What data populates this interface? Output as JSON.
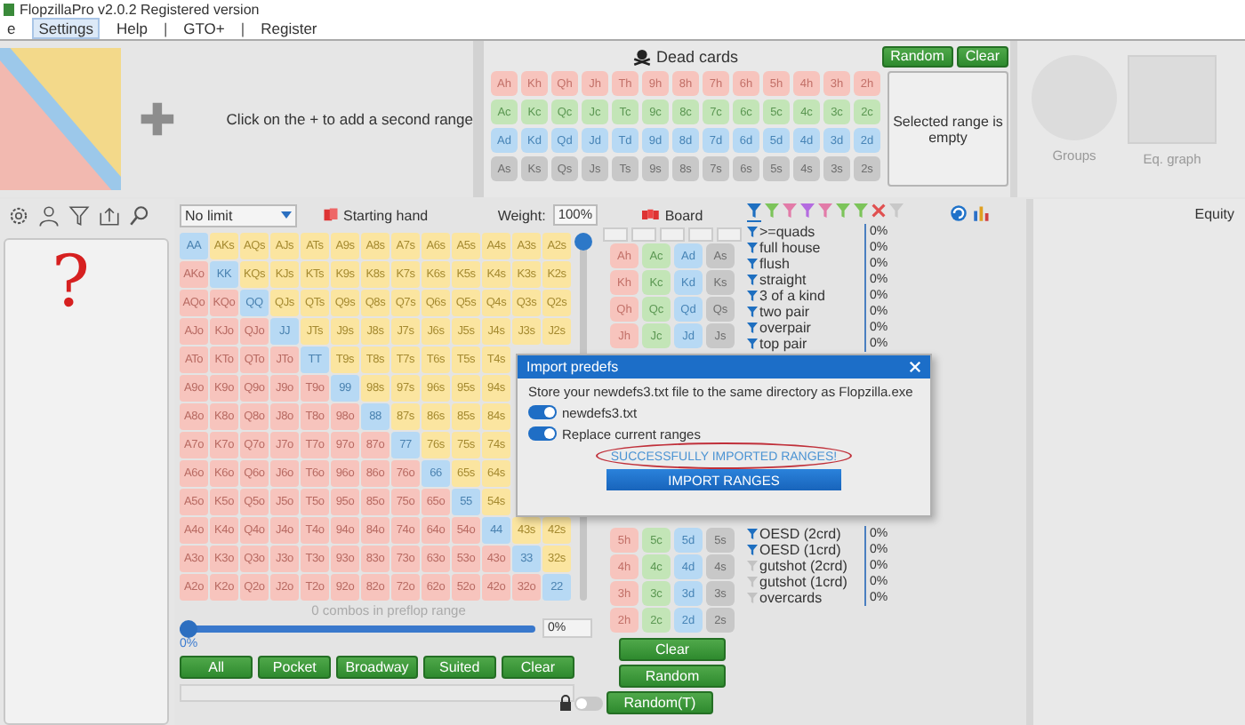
{
  "window": {
    "title": "FlopzillaPro v2.0.2 Registered version"
  },
  "menu": [
    {
      "kind": "item",
      "label": "e",
      "selected": false
    },
    {
      "kind": "item",
      "label": "Settings",
      "selected": true
    },
    {
      "kind": "item",
      "label": "Help",
      "selected": false
    },
    {
      "kind": "separator",
      "label": "|"
    },
    {
      "kind": "item",
      "label": "GTO+",
      "selected": false
    },
    {
      "kind": "separator",
      "label": "|"
    },
    {
      "kind": "item",
      "label": "Register",
      "selected": false
    }
  ],
  "second_range": {
    "hint": "Click on the + to add a second range"
  },
  "dead_cards": {
    "title": "Dead cards",
    "rows": [
      [
        "Ah",
        "Kh",
        "Qh",
        "Jh",
        "Th",
        "9h",
        "8h",
        "7h",
        "6h",
        "5h",
        "4h",
        "3h",
        "2h"
      ],
      [
        "Ac",
        "Kc",
        "Qc",
        "Jc",
        "Tc",
        "9c",
        "8c",
        "7c",
        "6c",
        "5c",
        "4c",
        "3c",
        "2c"
      ],
      [
        "Ad",
        "Kd",
        "Qd",
        "Jd",
        "Td",
        "9d",
        "8d",
        "7d",
        "6d",
        "5d",
        "4d",
        "3d",
        "2d"
      ],
      [
        "As",
        "Ks",
        "Qs",
        "Js",
        "Ts",
        "9s",
        "8s",
        "7s",
        "6s",
        "5s",
        "4s",
        "3s",
        "2s"
      ]
    ],
    "buttons": [
      "Random",
      "Clear"
    ],
    "summary": "Selected range is empty"
  },
  "analysis": {
    "groups_label": "Groups",
    "graph_label": "Eq. graph"
  },
  "sidebar": {
    "note": "?"
  },
  "range": {
    "game": "No limit",
    "title": "Starting hand",
    "weight_label": "Weight:",
    "weight": "100%",
    "weight_slider": {
      "level": 1
    },
    "grid": [
      [
        "AA",
        "AKs",
        "AQs",
        "AJs",
        "ATs",
        "A9s",
        "A8s",
        "A7s",
        "A6s",
        "A5s",
        "A4s",
        "A3s",
        "A2s"
      ],
      [
        "AKo",
        "KK",
        "KQs",
        "KJs",
        "KTs",
        "K9s",
        "K8s",
        "K7s",
        "K6s",
        "K5s",
        "K4s",
        "K3s",
        "K2s"
      ],
      [
        "AQo",
        "KQo",
        "QQ",
        "QJs",
        "QTs",
        "Q9s",
        "Q8s",
        "Q7s",
        "Q6s",
        "Q5s",
        "Q4s",
        "Q3s",
        "Q2s"
      ],
      [
        "AJo",
        "KJo",
        "QJo",
        "JJ",
        "JTs",
        "J9s",
        "J8s",
        "J7s",
        "J6s",
        "J5s",
        "J4s",
        "J3s",
        "J2s"
      ],
      [
        "ATo",
        "KTo",
        "QTo",
        "JTo",
        "TT",
        "T9s",
        "T8s",
        "T7s",
        "T6s",
        "T5s",
        "T4s"
      ],
      [
        "A9o",
        "K9o",
        "Q9o",
        "J9o",
        "T9o",
        "99",
        "98s",
        "97s",
        "96s",
        "95s",
        "94s"
      ],
      [
        "A8o",
        "K8o",
        "Q8o",
        "J8o",
        "T8o",
        "98o",
        "88",
        "87s",
        "86s",
        "85s",
        "84s"
      ],
      [
        "A7o",
        "K7o",
        "Q7o",
        "J7o",
        "T7o",
        "97o",
        "87o",
        "77",
        "76s",
        "75s",
        "74s"
      ],
      [
        "A6o",
        "K6o",
        "Q6o",
        "J6o",
        "T6o",
        "96o",
        "86o",
        "76o",
        "66",
        "65s",
        "64s"
      ],
      [
        "A5o",
        "K5o",
        "Q5o",
        "J5o",
        "T5o",
        "95o",
        "85o",
        "75o",
        "65o",
        "55",
        "54s"
      ],
      [
        "A4o",
        "K4o",
        "Q4o",
        "J4o",
        "T4o",
        "94o",
        "84o",
        "74o",
        "64o",
        "54o",
        "44",
        "43s",
        "42s"
      ],
      [
        "A3o",
        "K3o",
        "Q3o",
        "J3o",
        "T3o",
        "93o",
        "83o",
        "73o",
        "63o",
        "53o",
        "43o",
        "33",
        "32s"
      ],
      [
        "A2o",
        "K2o",
        "Q2o",
        "J2o",
        "T2o",
        "92o",
        "82o",
        "72o",
        "62o",
        "52o",
        "42o",
        "32o",
        "22"
      ]
    ],
    "combos": "0 combos in preflop range",
    "slider": {
      "level": 0,
      "min_label": "0%",
      "value": "0%"
    },
    "buttons": [
      "All",
      "Pocket",
      "Broadway",
      "Suited",
      "Clear"
    ]
  },
  "board": {
    "title": "Board",
    "upper_rows": [
      [
        "Ah",
        "Ac",
        "Ad",
        "As"
      ],
      [
        "Kh",
        "Kc",
        "Kd",
        "Ks"
      ],
      [
        "Qh",
        "Qc",
        "Qd",
        "Qs"
      ],
      [
        "Jh",
        "Jc",
        "Jd",
        "Js"
      ]
    ],
    "lower_rows": [
      [
        "5h",
        "5c",
        "5d",
        "5s"
      ],
      [
        "4h",
        "4c",
        "4d",
        "4s"
      ],
      [
        "3h",
        "3c",
        "3d",
        "3s"
      ],
      [
        "2h",
        "2c",
        "2d",
        "2s"
      ]
    ],
    "buttons": [
      "Clear",
      "Random",
      "Random(T)"
    ],
    "lock": {
      "on": false
    }
  },
  "stats": {
    "filters": [
      {
        "kind": "funnel",
        "color": "#1e6fc0",
        "selected": true
      },
      {
        "kind": "funnel",
        "color": "#7cc45a",
        "selected": false
      },
      {
        "kind": "funnel",
        "color": "#e27ba8",
        "selected": false
      },
      {
        "kind": "funnel",
        "color": "#b46be0",
        "selected": false
      },
      {
        "kind": "funnel",
        "color": "#e27ba8",
        "selected": false
      },
      {
        "kind": "funnel",
        "color": "#7cc45a",
        "selected": false
      },
      {
        "kind": "funnel",
        "color": "#7cc45a",
        "selected": false
      },
      {
        "kind": "clear",
        "selected": false
      },
      {
        "kind": "funnel",
        "color": "#c8c8c8",
        "selected": false
      }
    ],
    "upper": [
      {
        "label": ">=quads",
        "value": "0%",
        "active": true
      },
      {
        "label": "full house",
        "value": "0%",
        "active": true
      },
      {
        "label": "flush",
        "value": "0%",
        "active": true
      },
      {
        "label": "straight",
        "value": "0%",
        "active": true
      },
      {
        "label": "3 of a kind",
        "value": "0%",
        "active": true
      },
      {
        "label": "two pair",
        "value": "0%",
        "active": true
      },
      {
        "label": "overpair",
        "value": "0%",
        "active": true
      },
      {
        "label": "top pair",
        "value": "0%",
        "active": true
      }
    ],
    "lower": [
      {
        "label": "OESD (2crd)",
        "value": "0%",
        "active": true
      },
      {
        "label": "OESD (1crd)",
        "value": "0%",
        "active": true
      },
      {
        "label": "gutshot (2crd)",
        "value": "0%",
        "active": false
      },
      {
        "label": "gutshot (1crd)",
        "value": "0%",
        "active": false
      },
      {
        "label": "overcards",
        "value": "0%",
        "active": false
      }
    ]
  },
  "equity_panel": {
    "title": "Equity"
  },
  "dialog": {
    "title": "Import predefs",
    "message": "Store your newdefs3.txt file to the same directory as Flopzilla.exe",
    "options": [
      {
        "label": "newdefs3.txt",
        "on": true
      },
      {
        "label": "Replace current ranges",
        "on": true
      }
    ],
    "status": "SUCCESSFULLY IMPORTED RANGES!",
    "button": "IMPORT RANGES"
  }
}
